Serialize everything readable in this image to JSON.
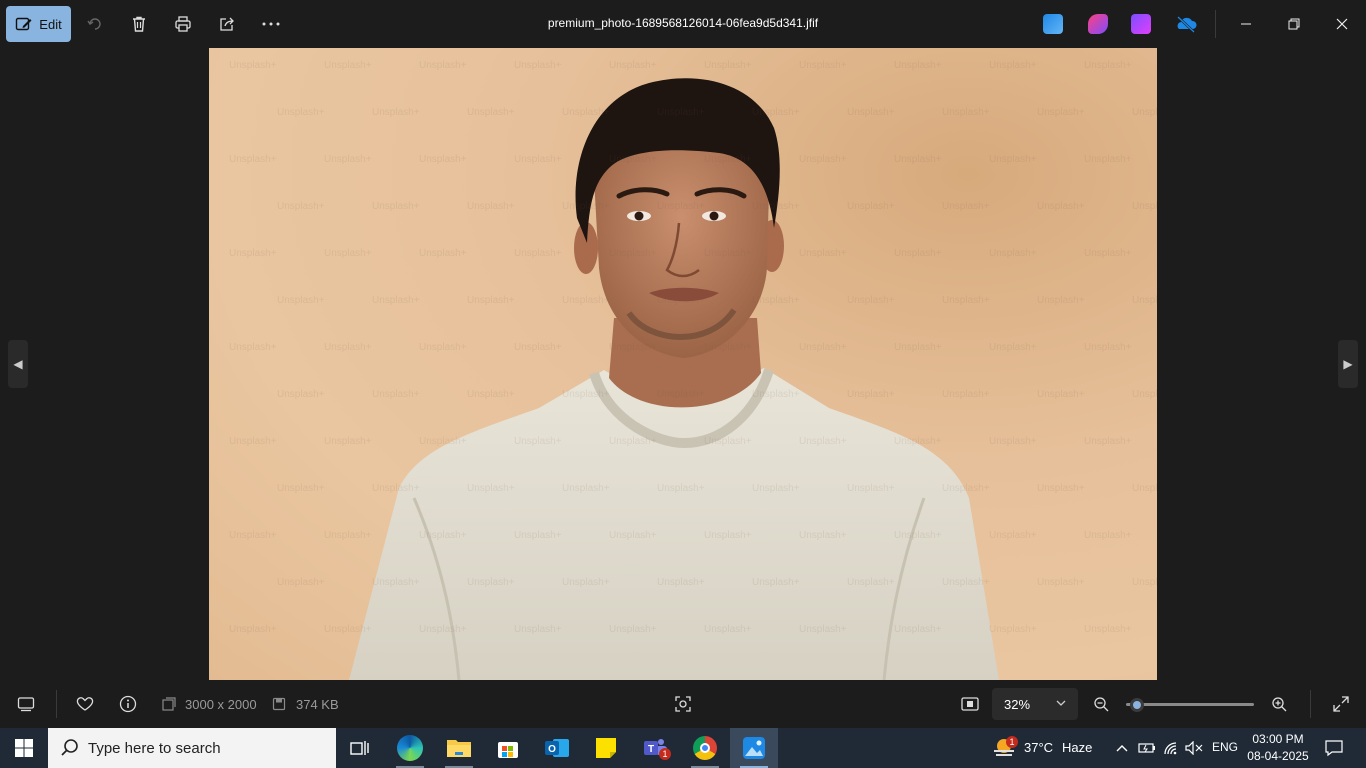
{
  "toolbar": {
    "edit_label": "Edit",
    "file_title": "premium_photo-1689568126014-06fea9d5d341.jfif"
  },
  "photo": {
    "watermark": "Unsplash+"
  },
  "bottom": {
    "dimensions": "3000 x 2000",
    "file_size": "374 KB",
    "zoom_value": "32%",
    "zoom_level": 0.05
  },
  "taskbar": {
    "search_placeholder": "Type here to search",
    "weather_temp": "37°C",
    "weather_desc": "Haze",
    "weather_badge": "1",
    "teams_badge": "1",
    "language": "ENG",
    "time": "03:00 PM",
    "date": "08-04-2025"
  },
  "colors": {
    "accent": "#8ab4e0",
    "background": "#1c1c1c",
    "taskbar": "#1f2a36"
  }
}
